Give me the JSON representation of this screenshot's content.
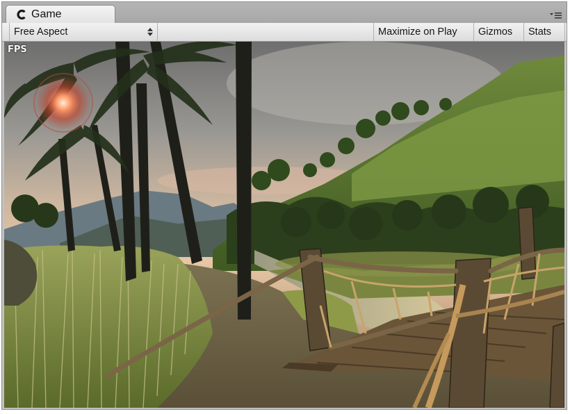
{
  "tab": {
    "label": "Game",
    "icon": "unity-game-icon",
    "menu_icon": "panel-menu-icon"
  },
  "toolbar": {
    "aspect": "Free Aspect",
    "maximize_on_play": "Maximize on Play",
    "gizmos": "Gizmos",
    "stats": "Stats"
  },
  "viewport": {
    "overlay_text": "FPS",
    "scene": "tropical island at sunset with palm trees, tall grass, wooden rope bridge and green hills"
  }
}
